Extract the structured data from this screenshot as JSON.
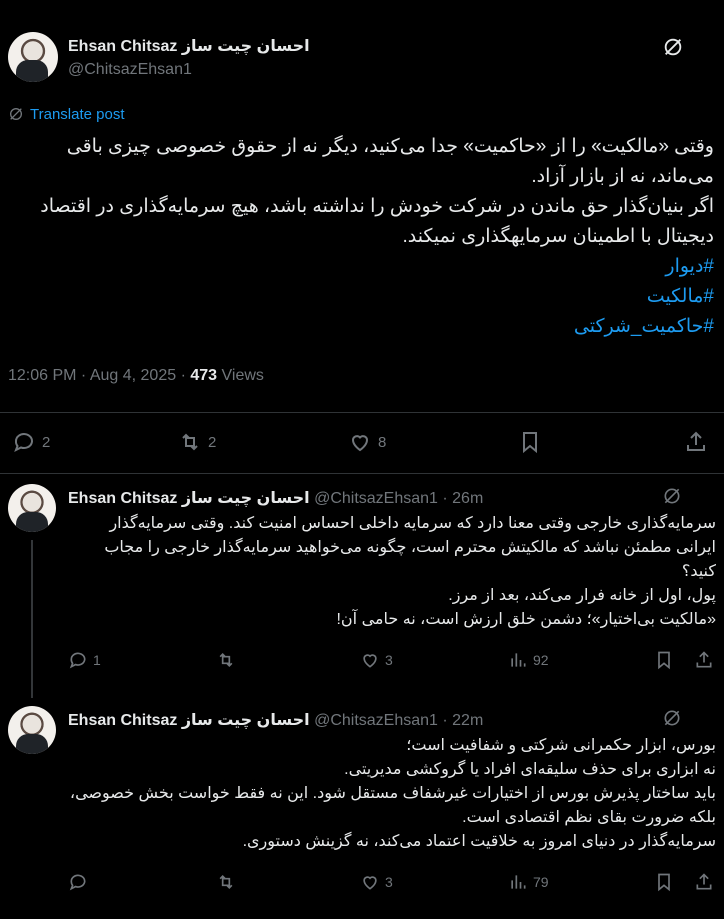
{
  "main_post": {
    "author_name": "Ehsan Chitsaz احسان چیت ساز",
    "handle": "@ChitsazEhsan1",
    "translate_label": "Translate post",
    "paragraphs": [
      "وقتی «مالکیت» را از «حاکمیت» جدا می‌کنید، دیگر نه از حقوق خصوصی چیزی باقی می‌ماند، نه از بازار آزاد.",
      "اگر بنیان‌گذار حق ماندن در شرکت خودش را نداشته باشد، هیچ سرمایه‌گذاری در اقتصاد دیجیتال با اطمینان سرمایهگذاری نمیکند."
    ],
    "hashtags": [
      "#دیوار",
      "#مالکیت",
      "#حاکمیت_شرکتی"
    ],
    "time": "12:06 PM",
    "date": "Aug 4, 2025",
    "views_count": "473",
    "views_label": "Views",
    "replies": "2",
    "reposts": "2",
    "likes": "8"
  },
  "replies": [
    {
      "author_name": "Ehsan Chitsaz احسان چیت ساز",
      "handle": "@ChitsazEhsan1",
      "age": "26m",
      "lines": [
        "سرمایه‌گذاری خارجی وقتی معنا دارد که سرمایه داخلی احساس امنیت کند. وقتی سرمایه‌گذار ایرانی مطمئن نباشد که مالکیتش محترم است، چگونه می‌خواهید سرمایه‌گذار خارجی را مجاب کنید؟",
        "پول، اول از خانه فرار می‌کند، بعد از مرز.",
        "«مالکیت بی‌اختیار»؛ دشمن خلق ارزش است، نه حامی آن!"
      ],
      "replies": "1",
      "reposts": "",
      "likes": "3",
      "views": "92"
    },
    {
      "author_name": "Ehsan Chitsaz احسان چیت ساز",
      "handle": "@ChitsazEhsan1",
      "age": "22m",
      "lines": [
        "بورس، ابزار حکمرانی شرکتی و شفافیت است؛",
        "نه ابزاری برای حذف سلیقه‌ای افراد یا گروکشی مدیریتی.",
        "باید ساختار پذیرش بورس از اختیارات غیرشفاف مستقل شود. این نه فقط خواست بخش خصوصی، بلکه ضرورت بقای نظم اقتصادی است.",
        "سرمایه‌گذار در دنیای امروز به خلاقیت اعتماد می‌کند، نه گزینش دستوری."
      ],
      "replies": "",
      "reposts": "",
      "likes": "3",
      "views": "79"
    }
  ],
  "colors": {
    "background": "#000000",
    "text": "#e7e9ea",
    "muted": "#71767b",
    "link": "#1d9bf0",
    "divider": "#2f3336"
  },
  "icons": [
    "grok-icon",
    "translate-icon",
    "reply-icon",
    "repost-icon",
    "like-icon",
    "bookmark-icon",
    "share-icon",
    "views-icon"
  ]
}
